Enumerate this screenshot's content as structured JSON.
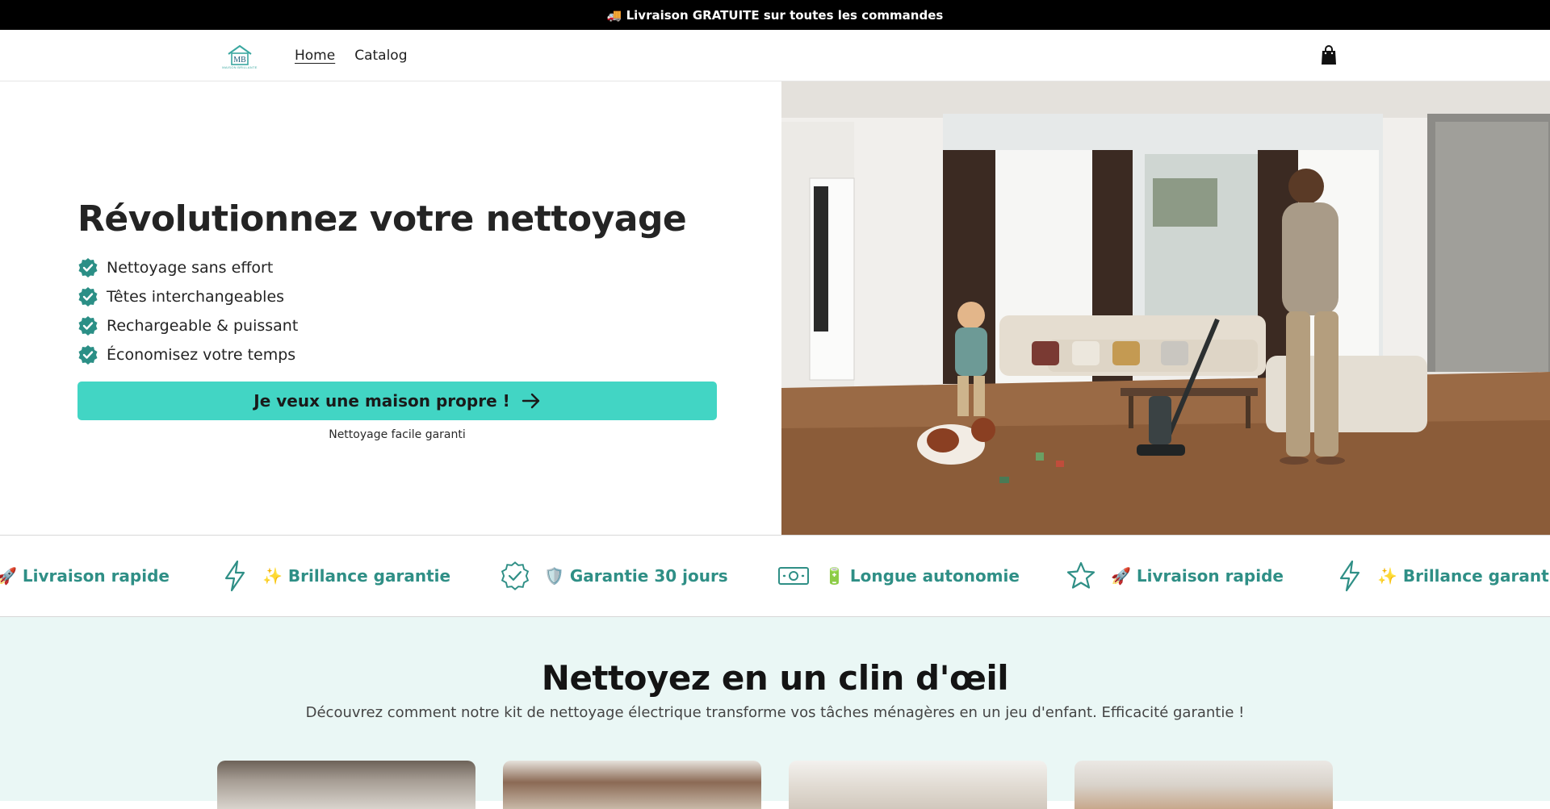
{
  "announcement": {
    "text": "🚚 Livraison GRATUITE sur toutes les commandes"
  },
  "header": {
    "logo_text": "MB",
    "logo_subtext": "MAISON BRILLANTE",
    "nav": [
      {
        "label": "Home",
        "active": true
      },
      {
        "label": "Catalog",
        "active": false
      }
    ],
    "cart_icon": "shopping-bag-icon"
  },
  "hero": {
    "title": "Révolutionnez votre nettoyage",
    "features": [
      "Nettoyage sans effort",
      "Têtes interchangeables",
      "Rechargeable & puissant",
      "Économisez votre temps"
    ],
    "check_icon": "badge-check-icon",
    "cta_label": "Je veux une maison propre !",
    "cta_icon": "arrow-right-icon",
    "cta_subtext": "Nettoyage facile garanti",
    "image_subject": "living-room-vacuum-scene"
  },
  "marquee": {
    "items": [
      {
        "label": "🚀 Livraison rapide",
        "icon": ""
      },
      {
        "label": "✨ Brillance garantie",
        "icon": "lightning-icon"
      },
      {
        "label": "🛡️ Garantie 30 jours",
        "icon": "badge-check-icon"
      },
      {
        "label": "🔋 Longue autonomie",
        "icon": "banknote-icon"
      },
      {
        "label": "🚀 Livraison rapide",
        "icon": "star-icon"
      },
      {
        "label": "✨ Brillance garantie",
        "icon": "lightning-icon"
      }
    ]
  },
  "section": {
    "title": "Nettoyez en un clin d'œil",
    "description": "Découvrez comment notre kit de nettoyage électrique transforme vos tâches ménagères en un jeu d'enfant. Efficacité garantie !"
  },
  "colors": {
    "accent": "#42d5c4",
    "teal_text": "#2f8f86",
    "section_bg": "#eaf7f5",
    "check": "#2b8f86"
  }
}
